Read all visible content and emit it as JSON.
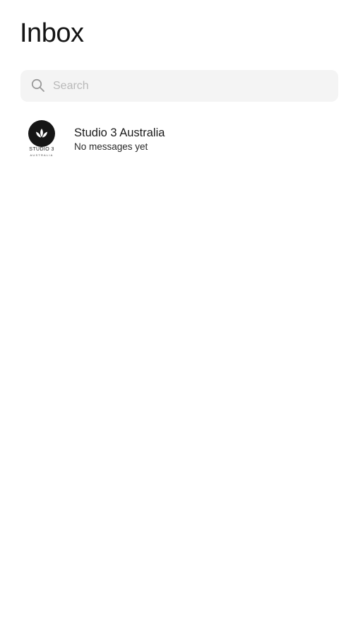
{
  "header": {
    "title": "Inbox"
  },
  "search": {
    "placeholder": "Search",
    "value": "",
    "icon": "search-icon"
  },
  "threads": [
    {
      "name": "Studio 3 Australia",
      "preview": "No messages yet",
      "avatar": {
        "icon": "lotus-icon",
        "brand_text": "STUDIO 3",
        "sub_text": "AUSTRALIA"
      }
    }
  ],
  "colors": {
    "background": "#ffffff",
    "search_background": "#f4f4f4",
    "placeholder": "#b9b9b9",
    "text": "#1a1a1a",
    "avatar_background": "#161616"
  }
}
